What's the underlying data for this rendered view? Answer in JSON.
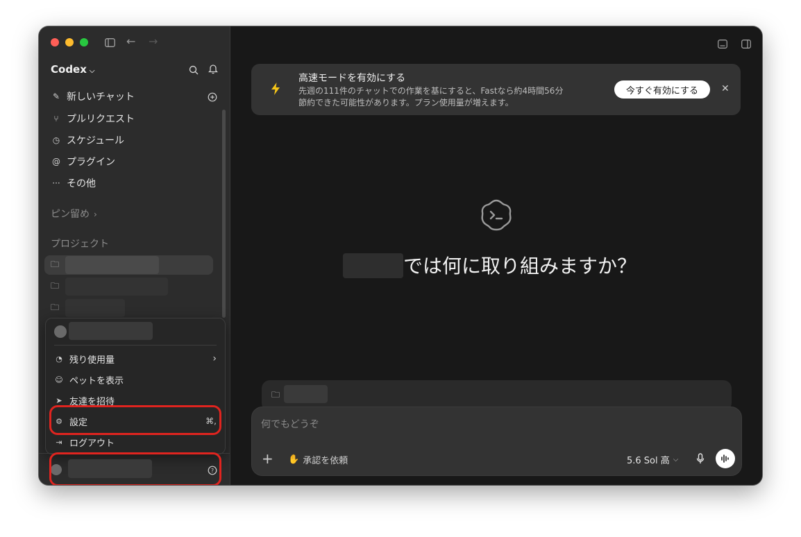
{
  "sidebar": {
    "app_title": "Codex",
    "nav": [
      {
        "label": "新しいチャット",
        "icon": "edit-icon"
      },
      {
        "label": "プルリクエスト",
        "icon": "pull-request-icon"
      },
      {
        "label": "スケジュール",
        "icon": "clock-icon"
      },
      {
        "label": "プラグイン",
        "icon": "plugin-icon"
      },
      {
        "label": "その他",
        "icon": "more-icon"
      }
    ],
    "pinned_label": "ピン留め",
    "projects_label": "プロジェクト"
  },
  "menu": {
    "items": [
      {
        "label": "残り使用量",
        "icon": "gauge-icon"
      },
      {
        "label": "ペットを表示",
        "icon": "pet-icon"
      },
      {
        "label": "友達を招待",
        "icon": "send-icon"
      },
      {
        "label": "設定",
        "icon": "gear-icon",
        "shortcut": "⌘,"
      },
      {
        "label": "ログアウト",
        "icon": "logout-icon"
      }
    ]
  },
  "banner": {
    "title": "高速モードを有効にする",
    "desc_line1": "先週の111件のチャットでの作業を基にすると、Fastなら約4時間56分",
    "desc_line2": "節約できた可能性があります。プラン使用量が増えます。",
    "button": "今すぐ有効にする"
  },
  "hero": {
    "suffix": "では何に取り組みますか？"
  },
  "composer": {
    "placeholder": "何でもどうぞ",
    "approval": "承認を依頼",
    "model": "5.6 Sol 高"
  },
  "colors": {
    "accent_red": "#e0241f",
    "bolt": "#f5c518"
  }
}
